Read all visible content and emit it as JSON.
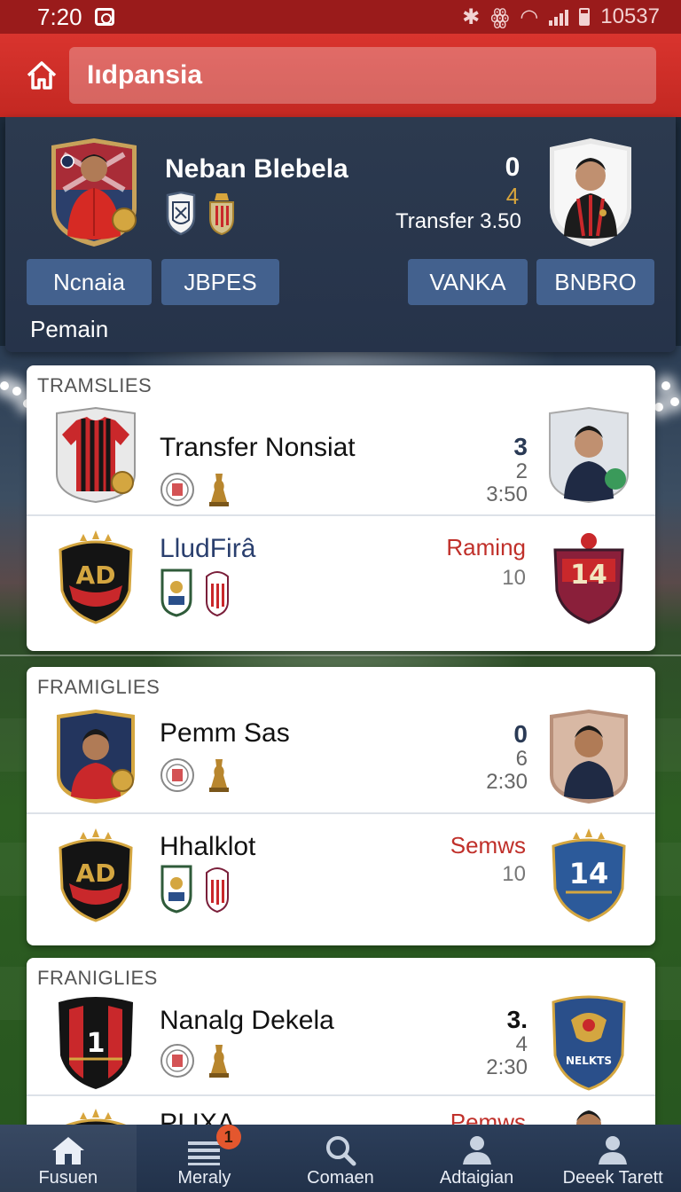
{
  "status_bar": {
    "time": "7:20",
    "battery_text": "10537"
  },
  "header": {
    "search_text": "Iıdpansia"
  },
  "hero": {
    "player_name": "Neban Blebela",
    "score_top": "0",
    "score_mid": "4",
    "transfer_text": "Transfer 3.50",
    "chips": [
      "Ncnaia",
      "JBPES",
      "VANKA",
      "BNBRO"
    ],
    "subtitle": "Pemain"
  },
  "sections": [
    {
      "title": "TRAMSLIES",
      "rows": [
        {
          "name": "Transfer Nonsiat",
          "n1": "3",
          "n2": "2",
          "n3": "3:50"
        },
        {
          "name": "LludFirâ",
          "status": "Raming",
          "n_small": "10"
        }
      ]
    },
    {
      "title": "FRAMIGLIES",
      "rows": [
        {
          "name": "Pemm Sas",
          "n1": "0",
          "n2": "6",
          "n3": "2:30"
        },
        {
          "name": "Hhalklot",
          "status": "Semws",
          "n_small": "10"
        }
      ]
    },
    {
      "title": "FRANIGLIES",
      "rows": [
        {
          "name": "Nanalg Dekela",
          "n1": "3.",
          "n2": "4",
          "n3": "2:30"
        },
        {
          "name": "PI IXA",
          "status": "Pemws"
        }
      ]
    }
  ],
  "bottom_nav": {
    "items": [
      {
        "label": "Fusuen",
        "icon": "home-icon"
      },
      {
        "label": "Meraly",
        "icon": "menu-icon",
        "badge": "1"
      },
      {
        "label": "Comaen",
        "icon": "search-icon"
      },
      {
        "label": "Adtaigian",
        "icon": "user-icon"
      },
      {
        "label": "Deeek Tarett",
        "icon": "user-icon"
      }
    ]
  },
  "colors": {
    "header_red": "#d9342e",
    "status_red": "#9a1b1b",
    "chip_blue": "#43618e",
    "nav_dark": "#22324a",
    "accent_red_text": "#c0302a",
    "gold": "#d8a53c"
  }
}
